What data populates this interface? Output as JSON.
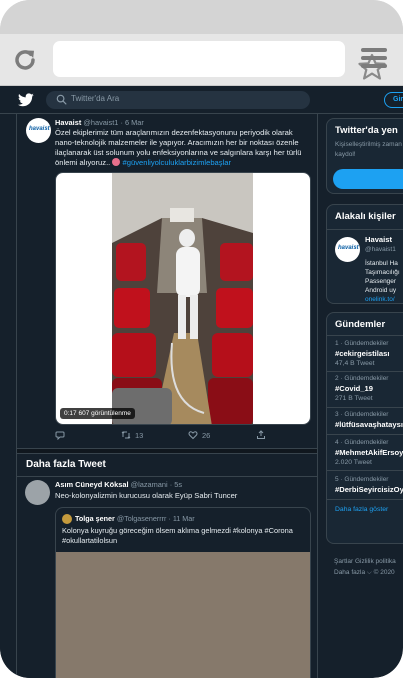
{
  "search": {
    "placeholder": "Twitter'da Ara"
  },
  "nav": {
    "login_label": "Gir"
  },
  "tweet": {
    "name": "Havaist",
    "meta": "@havaist1 · 6 Mar",
    "avatar_text": "havaist",
    "text": "Özel ekiplerimiz tüm araçlarımızın dezenfektasyonunu periyodik olarak nano-teknolojik malzemeler ile yapıyor. Aracımızın her bir noktası özenle ilaçlanarak üst solunum yolu enfeksiyonlarına ve salgınlara karşı her türlü önlemi alıyoruz..",
    "hashtag": "#güvenliyolculuklarbizimlebaşlar",
    "video_time": "0:17",
    "video_views": "607 görüntülenme",
    "retweets": "13",
    "likes": "26"
  },
  "more": {
    "title": "Daha fazla Tweet"
  },
  "tweet2": {
    "name": "Asım Cüneyd Köksal",
    "meta": "@lazamani · 5s",
    "text": "Neo-kolonyalizmin kurucusu olarak Eyüp Sabri Tuncer",
    "quote": {
      "name": "Tolga şener",
      "meta": "@Tolgasenerrrr · 11 Mar",
      "text": "Kolonya kuyruğu göreceğim ölsem aklıma gelmezdi #kolonya #Corona #okullartatilolsun"
    }
  },
  "sidebar": {
    "signup": {
      "title": "Twitter'da yen",
      "subtitle_1": "Kişiselleştirilmiş zaman",
      "subtitle_2": "kaydol!"
    },
    "people": {
      "title": "Alakalı kişiler",
      "avatar_text": "havaist",
      "name": "Havaist",
      "handle": "@havaist1",
      "bio_1": "İstanbul Ha",
      "bio_2": "Taşımacılığı",
      "bio_3": "Passenger",
      "bio_4": "Android uy",
      "link": "onelink.to/"
    },
    "trends": {
      "title": "Gündemler",
      "items": [
        {
          "ctx": "1 · Gündemdekiler",
          "name": "#cekirgeistilası",
          "count": "47,4 B Tweet"
        },
        {
          "ctx": "2 · Gündemdekiler",
          "name": "#Covid_19",
          "count": "271 B Tweet"
        },
        {
          "ctx": "3 · Gündemdekiler",
          "name": "#lütfüsavaşhataysı",
          "count": ""
        },
        {
          "ctx": "4 · Gündemdekiler",
          "name": "#MehmetAkifErsoy",
          "count": "2.020 Tweet"
        },
        {
          "ctx": "5 · Gündemdekiler",
          "name": "#DerbiSeyircisizOy",
          "count": ""
        }
      ],
      "more": "Daha fazla göster"
    },
    "footer": {
      "line1": "Şartlar   Gizlilik politika",
      "line2": "Daha fazla ⌵   © 2020"
    }
  }
}
